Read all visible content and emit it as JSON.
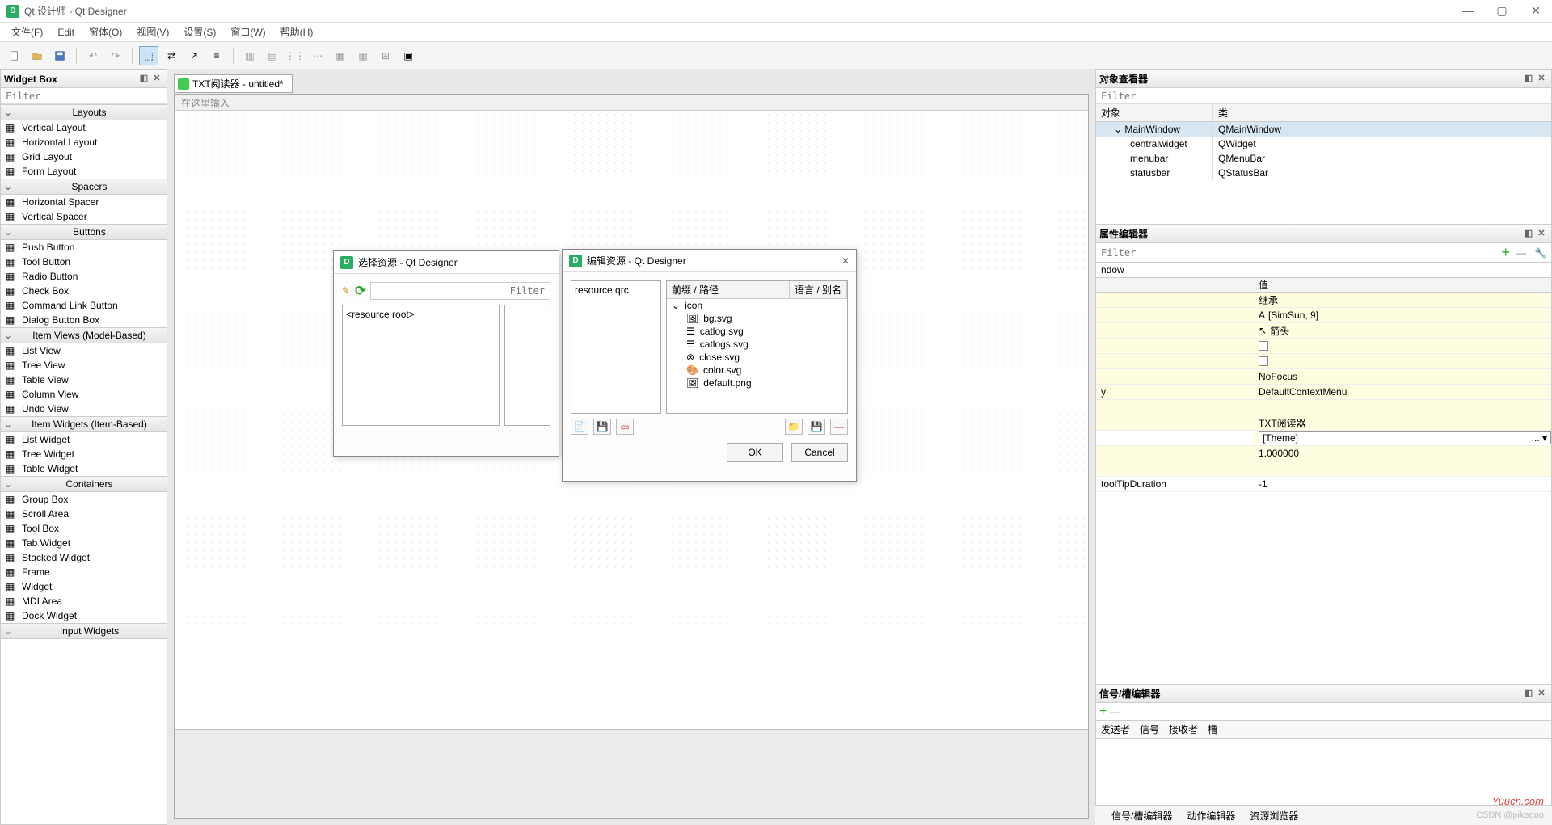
{
  "window": {
    "title": "Qt 设计师 - Qt Designer",
    "app_icon_letter": "D"
  },
  "menubar": [
    "文件(F)",
    "Edit",
    "窗体(O)",
    "视图(V)",
    "设置(S)",
    "窗口(W)",
    "帮助(H)"
  ],
  "widget_box": {
    "title": "Widget Box",
    "filter_placeholder": "Filter",
    "categories": [
      {
        "name": "Layouts",
        "items": [
          "Vertical Layout",
          "Horizontal Layout",
          "Grid Layout",
          "Form Layout"
        ]
      },
      {
        "name": "Spacers",
        "items": [
          "Horizontal Spacer",
          "Vertical Spacer"
        ]
      },
      {
        "name": "Buttons",
        "items": [
          "Push Button",
          "Tool Button",
          "Radio Button",
          "Check Box",
          "Command Link Button",
          "Dialog Button Box"
        ]
      },
      {
        "name": "Item Views (Model-Based)",
        "items": [
          "List View",
          "Tree View",
          "Table View",
          "Column View",
          "Undo View"
        ]
      },
      {
        "name": "Item Widgets (Item-Based)",
        "items": [
          "List Widget",
          "Tree Widget",
          "Table Widget"
        ]
      },
      {
        "name": "Containers",
        "items": [
          "Group Box",
          "Scroll Area",
          "Tool Box",
          "Tab Widget",
          "Stacked Widget",
          "Frame",
          "Widget",
          "MDI Area",
          "Dock Widget"
        ]
      },
      {
        "name": "Input Widgets",
        "items": []
      }
    ]
  },
  "canvas": {
    "tab_title": "TXT阅读器 - untitled*",
    "menubar_hint": "在这里输入"
  },
  "object_inspector": {
    "title": "对象查看器",
    "filter_placeholder": "Filter",
    "headers": [
      "对象",
      "类"
    ],
    "rows": [
      {
        "name": "MainWindow",
        "class": "QMainWindow",
        "depth": 0,
        "selected": true
      },
      {
        "name": "centralwidget",
        "class": "QWidget",
        "depth": 1
      },
      {
        "name": "menubar",
        "class": "QMenuBar",
        "depth": 1
      },
      {
        "name": "statusbar",
        "class": "QStatusBar",
        "depth": 1
      }
    ]
  },
  "property_editor": {
    "title": "属性编辑器",
    "filter_placeholder": "Filter",
    "combo_label": "ndow",
    "headers": [
      "",
      "值"
    ],
    "rows": [
      {
        "name": "",
        "value": "继承",
        "yellow": true
      },
      {
        "name": "",
        "value": "[SimSun, 9]",
        "yellow": true,
        "icon": "A"
      },
      {
        "name": "",
        "value": "箭头",
        "yellow": true,
        "icon": "↖"
      },
      {
        "name": "",
        "value": "",
        "yellow": true,
        "checkbox": true
      },
      {
        "name": "",
        "value": "",
        "yellow": true,
        "checkbox": true
      },
      {
        "name": "",
        "value": "NoFocus",
        "yellow": true
      },
      {
        "name": "y",
        "value": "DefaultContextMenu",
        "yellow": true
      },
      {
        "name": "",
        "value": "",
        "yellow": true
      },
      {
        "name": "",
        "value": "TXT阅读器",
        "yellow": true
      },
      {
        "name": "",
        "value": "[Theme]",
        "highlight": true,
        "selector": true
      },
      {
        "name": "",
        "value": "1.000000",
        "yellow": true
      },
      {
        "name": "",
        "value": "",
        "yellow": true
      },
      {
        "name": "toolTipDuration",
        "value": "-1",
        "yellow": false
      }
    ]
  },
  "signal_editor": {
    "title": "信号/槽编辑器",
    "headers": [
      "发送者",
      "信号",
      "接收者",
      "槽"
    ]
  },
  "bottom_tabs": [
    "信号/槽编辑器",
    "动作编辑器",
    "资源浏览器"
  ],
  "dialog_resource": {
    "title": "选择资源 - Qt Designer",
    "filter_placeholder": "Filter",
    "root_label": "<resource root>"
  },
  "dialog_edit": {
    "title": "编辑资源 - Qt Designer",
    "qrc_file": "resource.qrc",
    "headers": [
      "前缀 / 路径",
      "语言 / 别名"
    ],
    "folder": "icon",
    "files": [
      "bg.svg",
      "catlog.svg",
      "catlogs.svg",
      "close.svg",
      "color.svg",
      "default.png"
    ],
    "ok": "OK",
    "cancel": "Cancel"
  },
  "watermark": "Yuucn.com",
  "watermark2": "CSDN @pikeduo"
}
